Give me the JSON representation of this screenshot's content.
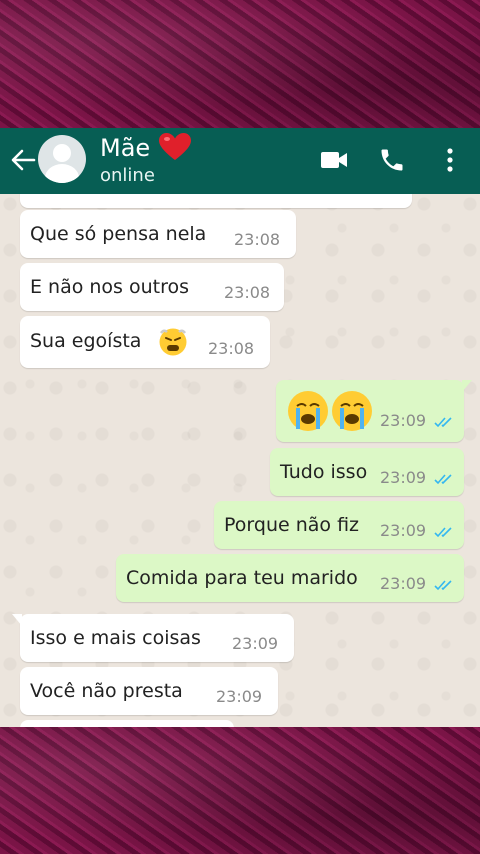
{
  "header": {
    "title": "Mãe",
    "status": "online",
    "icons": [
      "back-arrow-icon",
      "avatar",
      "heart-emoji",
      "video-call-icon",
      "phone-call-icon",
      "more-options-icon"
    ]
  },
  "messages": [
    {
      "dir": "in",
      "text": "Que só pensa nela",
      "time": "23:08"
    },
    {
      "dir": "in",
      "text": "E não nos outros",
      "time": "23:08"
    },
    {
      "dir": "in",
      "text": "Sua egoísta",
      "time": "23:08",
      "emoji": "angry-face"
    },
    {
      "dir": "out",
      "text": "",
      "time": "23:09",
      "emoji": "crying-faces"
    },
    {
      "dir": "out",
      "text": "Tudo isso",
      "time": "23:09"
    },
    {
      "dir": "out",
      "text": "Porque não fiz",
      "time": "23:09"
    },
    {
      "dir": "out",
      "text": "Comida para teu marido",
      "time": "23:09"
    },
    {
      "dir": "in",
      "text": "Isso e mais coisas",
      "time": "23:09"
    },
    {
      "dir": "in",
      "text": "Você não presta",
      "time": "23:09"
    }
  ],
  "colors": {
    "header": "#075e54",
    "incoming": "#ffffff",
    "outgoing": "#dcf8c6",
    "read_ticks": "#34b7f1",
    "frame": "#6b0f3d"
  }
}
